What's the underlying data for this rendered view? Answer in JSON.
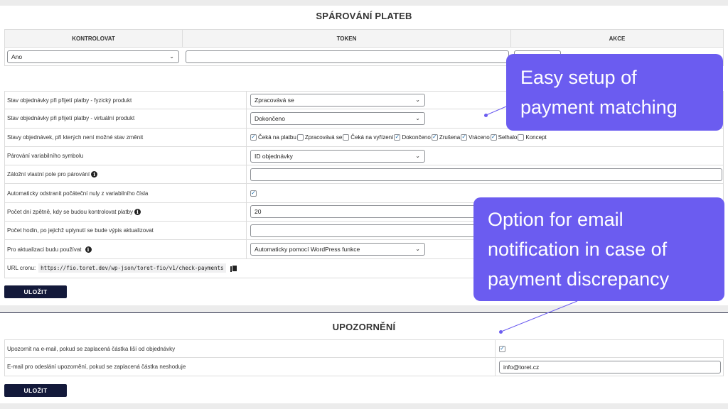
{
  "payments": {
    "title": "SPÁROVÁNÍ PLATEB",
    "columns": [
      "KONTROLOVAT",
      "TOKEN",
      "AKCE"
    ],
    "row": {
      "check_value": "Ano",
      "token_value": ""
    }
  },
  "settings": {
    "rows": [
      {
        "label": "Stav objednávky při přijetí platby - fyzický produkt",
        "value": "Zpracovává se"
      },
      {
        "label": "Stav objednávky při přijetí platby - virtuální produkt",
        "value": "Dokončeno"
      },
      {
        "label": "Stavy objednávek, při kterých není možné stav změnit"
      },
      {
        "label": "Párování variabilního symbolu",
        "value": "ID objednávky"
      },
      {
        "label": "Záložní vlastní pole pro párování",
        "value": ""
      },
      {
        "label": "Automaticky odstranit počáteční nuly z variabilního čísla"
      },
      {
        "label": "Počet dní zpětně, kdy se budou kontrolovat platby",
        "value": "20"
      },
      {
        "label": "Počet hodin, po jejichž uplynutí se bude výpis aktualizovat",
        "value": ""
      },
      {
        "label": "Pro aktualizaci budu používat",
        "value": "Automaticky pomocí WordPress funkce"
      },
      {
        "label": "URL cronu:",
        "value": "https://fio.toret.dev/wp-json/toret-fio/v1/check-payments"
      }
    ],
    "statuses": [
      {
        "label": "Čeká na platbu",
        "checked": true
      },
      {
        "label": "Zpracovává se",
        "checked": false
      },
      {
        "label": "Čeká na vyřízení",
        "checked": false
      },
      {
        "label": "Dokončeno",
        "checked": true
      },
      {
        "label": "Zrušena",
        "checked": true
      },
      {
        "label": "Vráceno",
        "checked": true
      },
      {
        "label": "Selhalo",
        "checked": true
      },
      {
        "label": "Koncept",
        "checked": false
      }
    ],
    "save_label": "ULOŽIT"
  },
  "notifications": {
    "title": "UPOZORNĚNÍ",
    "rows": [
      {
        "label": "Upozornit na e-mail, pokud se zaplacená částka liší od objednávky"
      },
      {
        "label": "E-mail pro odeslání upozornění, pokud se zaplacená částka neshoduje",
        "value": "info@toret.cz"
      }
    ],
    "save_label": "ULOŽIT"
  },
  "callouts": {
    "first": [
      "Easy setup of",
      "payment matching"
    ],
    "second": [
      "Option for email",
      "notification in case of",
      "payment discrepancy"
    ]
  },
  "colors": {
    "accent": "#6b5cf0",
    "button": "#13193a",
    "check": "#2271b1"
  }
}
